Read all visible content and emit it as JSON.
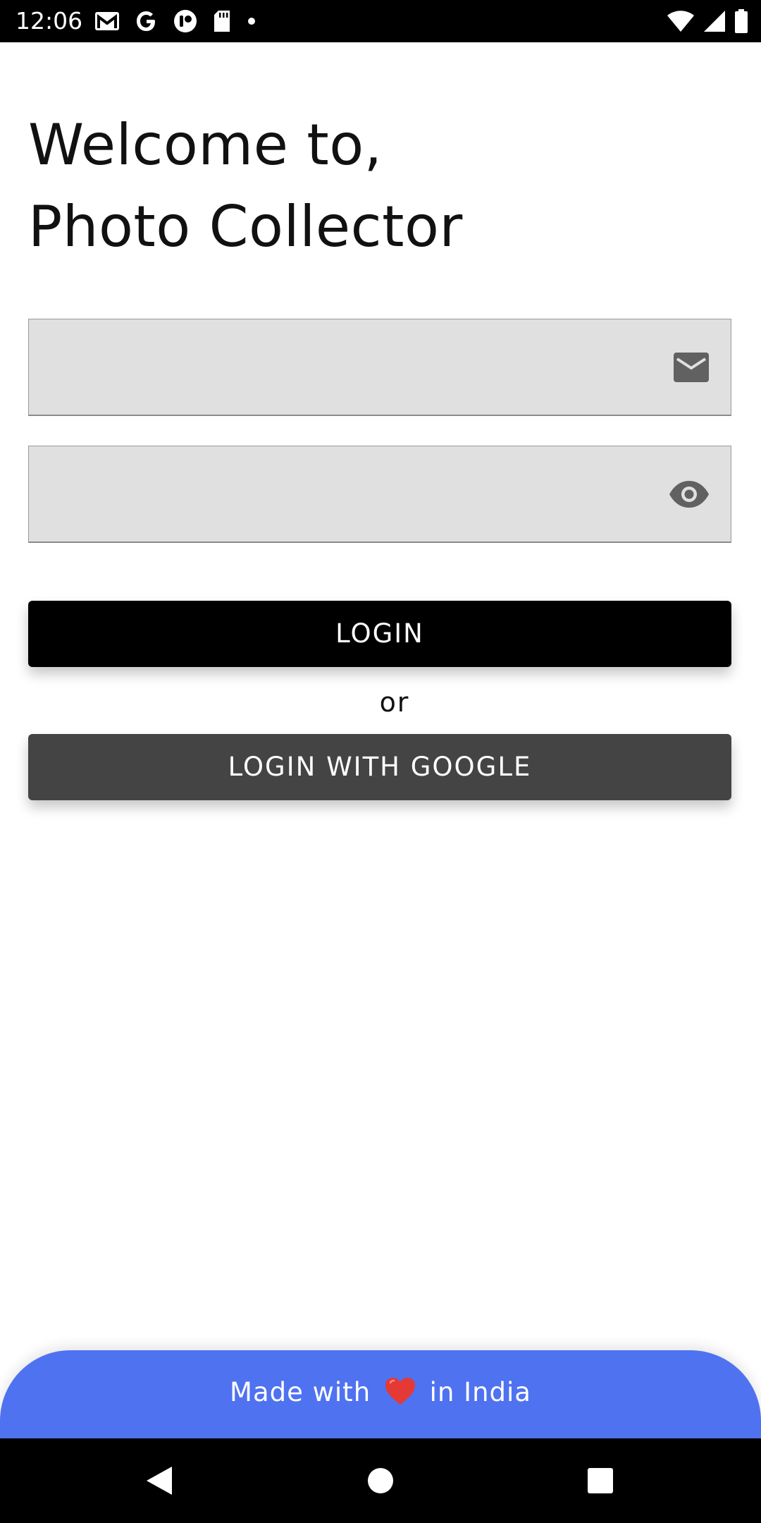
{
  "status_bar": {
    "time": "12:06",
    "left_icons": [
      "gmail-icon",
      "google-icon",
      "app-icon",
      "sd-card-icon",
      "dot-icon"
    ],
    "right_icons": [
      "wifi-icon",
      "signal-icon",
      "battery-icon"
    ]
  },
  "header": {
    "line1": "Welcome to,",
    "line2": "Photo Collector"
  },
  "form": {
    "email": {
      "value": "",
      "placeholder": "",
      "icon": "mail-icon"
    },
    "password": {
      "value": "",
      "placeholder": "",
      "icon": "eye-icon"
    },
    "login_label": "LOGIN",
    "or_label": "or",
    "google_label": "LOGIN WITH GOOGLE"
  },
  "footer": {
    "text_before": "Made with",
    "text_after": "in India",
    "icon": "heart-icon",
    "color": "#4f72f0"
  },
  "nav_bar": {
    "buttons": [
      "back-icon",
      "home-icon",
      "recents-icon"
    ]
  },
  "colors": {
    "login_button": "#000000",
    "google_button": "#444444",
    "field_background": "#e0e0e0",
    "accent": "#4f72f0"
  }
}
